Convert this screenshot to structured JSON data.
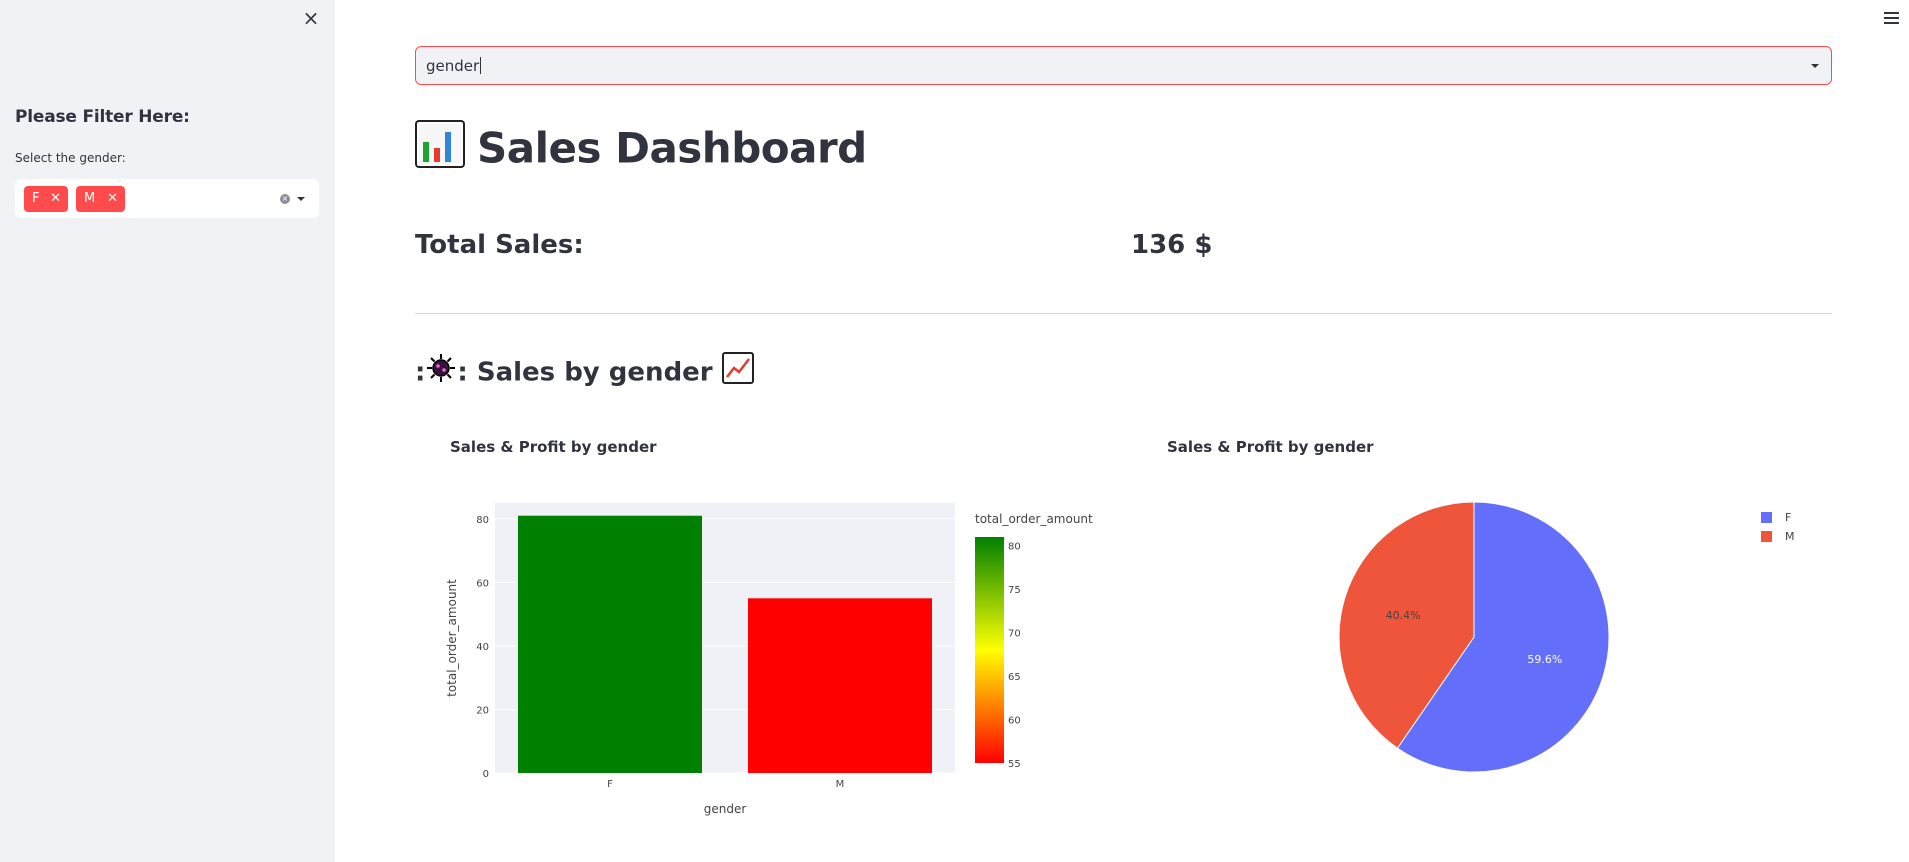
{
  "sidebar": {
    "close_icon": "×",
    "heading": "Please Filter Here:",
    "select_label": "Select the gender:",
    "selected_tags": [
      "F",
      "M"
    ],
    "tag_remove_glyph": "✕"
  },
  "main": {
    "top_select": {
      "value": "gender"
    },
    "title": "Sales Dashboard",
    "title_icon": "bar-chart-emoji-icon",
    "total_sales_label": "Total Sales:",
    "total_sales_value": "136 $",
    "section_title": {
      "prefix": ":",
      "middle": ": Sales by gender",
      "icons": [
        "virus-emoji-icon",
        "chart-increasing-emoji-icon"
      ]
    }
  },
  "charts": {
    "bar": {
      "title": "Sales & Profit by gender"
    },
    "pie": {
      "title": "Sales & Profit by gender"
    }
  },
  "chart_data": [
    {
      "type": "bar",
      "title": "Sales & Profit by gender",
      "categories": [
        "F",
        "M"
      ],
      "values": [
        81,
        55
      ],
      "colors": [
        "#008000",
        "#ff0000"
      ],
      "xlabel": "gender",
      "ylabel": "total_order_amount",
      "ylim": [
        0,
        85
      ],
      "yticks": [
        0,
        20,
        40,
        60,
        80
      ],
      "grid": true,
      "colorbar": {
        "title": "total_order_amount",
        "ticks": [
          80,
          75,
          70,
          65,
          60,
          55
        ],
        "range": [
          55,
          81
        ],
        "colors": [
          "#ff0000",
          "#ffff00",
          "#008000"
        ]
      }
    },
    {
      "type": "pie",
      "title": "Sales & Profit by gender",
      "labels": [
        "F",
        "M"
      ],
      "values": [
        59.6,
        40.4
      ],
      "value_labels": [
        "59.6%",
        "40.4%"
      ],
      "colors": [
        "#636efa",
        "#ef553b"
      ],
      "legend": "top-right"
    }
  ]
}
